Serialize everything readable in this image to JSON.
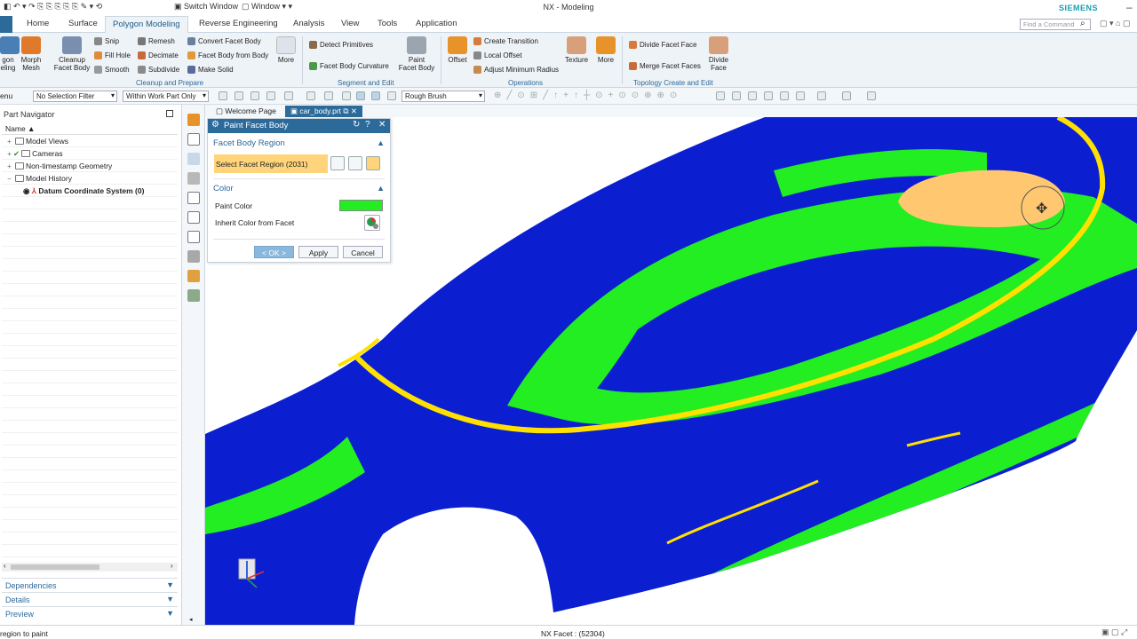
{
  "app": {
    "title": "NX - Modeling",
    "brand": "SIEMENS",
    "switch_window": "Switch Window",
    "window_menu": "Window"
  },
  "tabs": [
    "Home",
    "Surface",
    "Polygon Modeling",
    "Reverse Engineering",
    "Analysis",
    "View",
    "Tools",
    "Application"
  ],
  "active_tab": "Polygon Modeling",
  "search": {
    "placeholder": "Find a Command"
  },
  "ribbon": {
    "big": {
      "polygon_modeling": "gon\neling",
      "morph_mesh": "Morph\nMesh",
      "cleanup": "Cleanup\nFacet Body",
      "more1": "More",
      "paint": "Paint\nFacet Body",
      "offset": "Offset",
      "texture": "Texture",
      "more2": "More",
      "divide_face": "Divide\nFace"
    },
    "small": {
      "snip": "Snip",
      "fill_hole": "Fill Hole",
      "smooth": "Smooth",
      "remesh": "Remesh",
      "decimate": "Decimate",
      "subdivide": "Subdivide",
      "convert": "Convert Facet Body",
      "from_body": "Facet Body from Body",
      "make_solid": "Make Solid",
      "detect": "Detect Primitives",
      "curvature": "Facet Body Curvature",
      "create_transition": "Create Transition",
      "local_offset": "Local Offset",
      "adjust_radius": "Adjust Minimum Radius",
      "divide_facet_face": "Divide Facet Face",
      "merge_facet_faces": "Merge Facet Faces"
    },
    "groups": {
      "cleanup": "Cleanup and Prepare",
      "segment": "Segment and Edit",
      "operations": "Operations",
      "topology": "Topology Create and Edit"
    }
  },
  "toolbar2": {
    "menu": "enu",
    "filter": "No Selection Filter",
    "scope": "Within Work Part Only",
    "brush": "Rough Brush"
  },
  "navigator": {
    "title": "Part Navigator",
    "column": "Name",
    "items": [
      "Model Views",
      "Cameras",
      "Non-timestamp Geometry",
      "Model History",
      "Datum Coordinate System (0)"
    ],
    "sections": [
      "Dependencies",
      "Details",
      "Preview"
    ]
  },
  "doc_tabs": [
    "Welcome Page",
    "car_body.prt"
  ],
  "dialog": {
    "title": "Paint Facet Body",
    "section1": "Facet Body Region",
    "select_region": "Select Facet Region (2031)",
    "section2": "Color",
    "paint_color_label": "Paint Color",
    "paint_color": "#22ee22",
    "inherit_label": "Inherit Color from Facet",
    "ok": "< OK >",
    "apply": "Apply",
    "cancel": "Cancel"
  },
  "status": {
    "left": "region to paint",
    "mid": "NX Facet : (52304)"
  },
  "colors": {
    "accent": "#2c6a9a",
    "body_blue": "#0b1fd1",
    "body_green": "#22ee22",
    "body_yellow": "#ffe000",
    "paint_orange": "#ffc870"
  }
}
